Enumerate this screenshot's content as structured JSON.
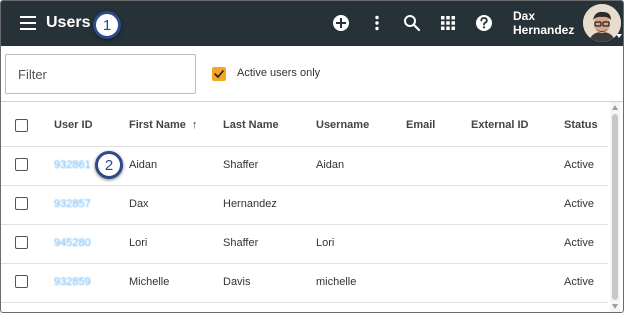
{
  "header": {
    "title": "Users",
    "user_first": "Dax",
    "user_last": "Hernandez"
  },
  "callouts": [
    "1",
    "2"
  ],
  "filter": {
    "placeholder": "Filter",
    "value": ""
  },
  "active_only": {
    "label": "Active users only",
    "checked": true
  },
  "table": {
    "columns": [
      "User ID",
      "First Name",
      "Last Name",
      "Username",
      "Email",
      "External ID",
      "Status"
    ],
    "sort_indicator": "↑",
    "rows": [
      {
        "user_id": "932861",
        "first_name": "Aidan",
        "last_name": "Shaffer",
        "username": "Aidan",
        "email": "",
        "external_id": "",
        "status": "Active"
      },
      {
        "user_id": "932857",
        "first_name": "Dax",
        "last_name": "Hernandez",
        "username": "",
        "email": "",
        "external_id": "",
        "status": "Active"
      },
      {
        "user_id": "945280",
        "first_name": "Lori",
        "last_name": "Shaffer",
        "username": "Lori",
        "email": "",
        "external_id": "",
        "status": "Active"
      },
      {
        "user_id": "932859",
        "first_name": "Michelle",
        "last_name": "Davis",
        "username": "michelle",
        "email": "",
        "external_id": "",
        "status": "Active"
      }
    ]
  },
  "colors": {
    "appbar": "#263238",
    "accent": "#f5a623",
    "link": "#64b5f6",
    "callout_border": "#2e4a87"
  },
  "icons": [
    "menu-icon",
    "add-circle-icon",
    "more-vert-icon",
    "search-icon",
    "apps-grid-icon",
    "help-icon"
  ]
}
